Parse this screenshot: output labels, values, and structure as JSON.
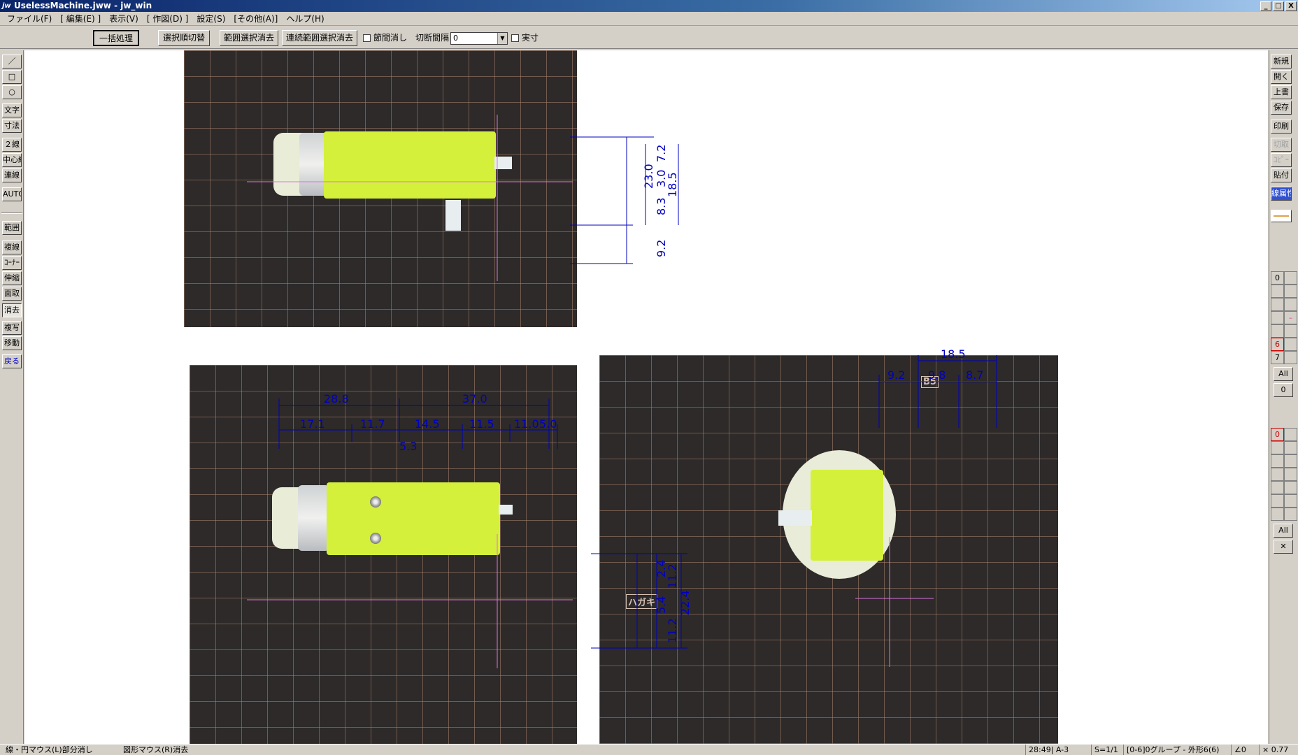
{
  "window": {
    "app_icon": "jw",
    "title": "UselessMachine.jww - jw_win",
    "buttons": [
      "_",
      "□",
      "X"
    ]
  },
  "menu": [
    "ファイル(F)",
    "[ 編集(E) ]",
    "表示(V)",
    "[ 作図(D) ]",
    "設定(S)",
    "[その他(A)]",
    "ヘルプ(H)"
  ],
  "toolbar": {
    "bulk_process": "一括処理",
    "select_order": "選択順切替",
    "range_clear": "範囲選択消去",
    "continuous_clear": "連続範囲選択消去",
    "node_clear_label": "節間消し",
    "cut_interval_label": "切断間隔",
    "cut_interval_value": "0",
    "actual_size_label": "実寸"
  },
  "left_tools": {
    "line": "／",
    "rect": "□",
    "circle": "○",
    "text": "文字",
    "dimension": "寸法",
    "double_line": "２線",
    "center_line": "中心線",
    "continuous_line": "連線",
    "auto": "AUTO",
    "range": "範囲",
    "multi_line": "複線",
    "corner": "ｺｰﾅｰ",
    "stretch": "伸縮",
    "chamfer": "面取",
    "erase": "消去",
    "copy": "複写",
    "move": "移動",
    "undo": "戻る"
  },
  "right_tools": {
    "new": "新規",
    "open": "開く",
    "overwrite": "上書",
    "save": "保存",
    "print": "印刷",
    "cut": "切取",
    "copy": "ｺﾋﾟｰ",
    "paste": "貼付",
    "line_attr": "線属性",
    "layer_group_top": "0",
    "layer_marked_6": "6",
    "layer_marked_7": "7",
    "all_top": "All",
    "zero_top": "0",
    "layer_bottom_first": "0",
    "all_bottom": "All",
    "close_x": "✕"
  },
  "dimensions": {
    "top_view": [
      "23.0",
      "7.2",
      "8.3",
      "3.0",
      "18.5",
      "9.2"
    ],
    "bottom_view_upper": [
      "28.8",
      "37.0"
    ],
    "bottom_view_lower": [
      "17.1",
      "11.7",
      "14.5",
      "11.5",
      "11.0",
      "5.0"
    ],
    "bottom_view_small": "5.3",
    "side_view_vertical": [
      "2.4",
      "11.2",
      "5.4",
      "11.2",
      "22.4"
    ],
    "end_view_top": "18.5",
    "end_view_lower": [
      "9.2",
      "9.8",
      "8.7"
    ]
  },
  "photo_stamps": {
    "size_mark": "B5",
    "card_mark": "ハガキ"
  },
  "status": {
    "left_hint": "線・円マウス(L)部分消し",
    "right_hint": "図形マウス(R)消去",
    "paper": "28:49| A-3",
    "scale": "S=1/1",
    "group": "[0-6]0グループ - 外形6(6)",
    "angle": "∠0",
    "zoom": "× 0.77"
  },
  "colors": {
    "dimension": "#0000c0",
    "crosshair": "#e070e0",
    "motor_yellow": "#d4f03a"
  }
}
